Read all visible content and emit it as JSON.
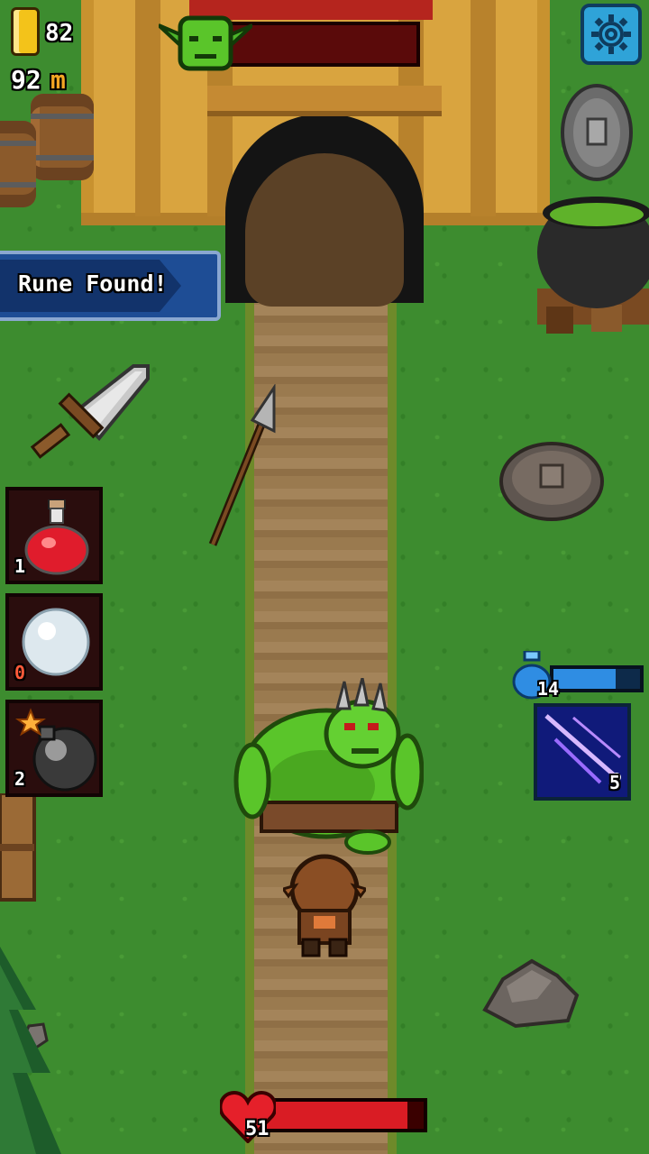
{
  "hud": {
    "gold": "82",
    "distance": "92",
    "distance_unit": "m",
    "boss_health": 0.0,
    "settings_icon": "gear-icon"
  },
  "notification": {
    "text": "Rune Found!"
  },
  "inventory": [
    {
      "item": "health-potion",
      "icon": "red-potion-icon",
      "count": "1"
    },
    {
      "item": "snowball",
      "icon": "snowball-icon",
      "count": "0"
    },
    {
      "item": "bomb",
      "icon": "bomb-icon",
      "count": "2"
    }
  ],
  "spell": {
    "icon": "magic-streak-icon",
    "count": "5",
    "mana_value": "14",
    "mana_fill": 0.72
  },
  "player": {
    "hp": "51",
    "hp_fill": 0.9
  },
  "colors": {
    "grass": "#3d8c2f",
    "path": "#9a7a4f",
    "tent": "#d9a43f",
    "banner": "#1e4d95",
    "hp": "#d91c24",
    "mana": "#2f8de3",
    "settings": "#2fa3d8"
  }
}
